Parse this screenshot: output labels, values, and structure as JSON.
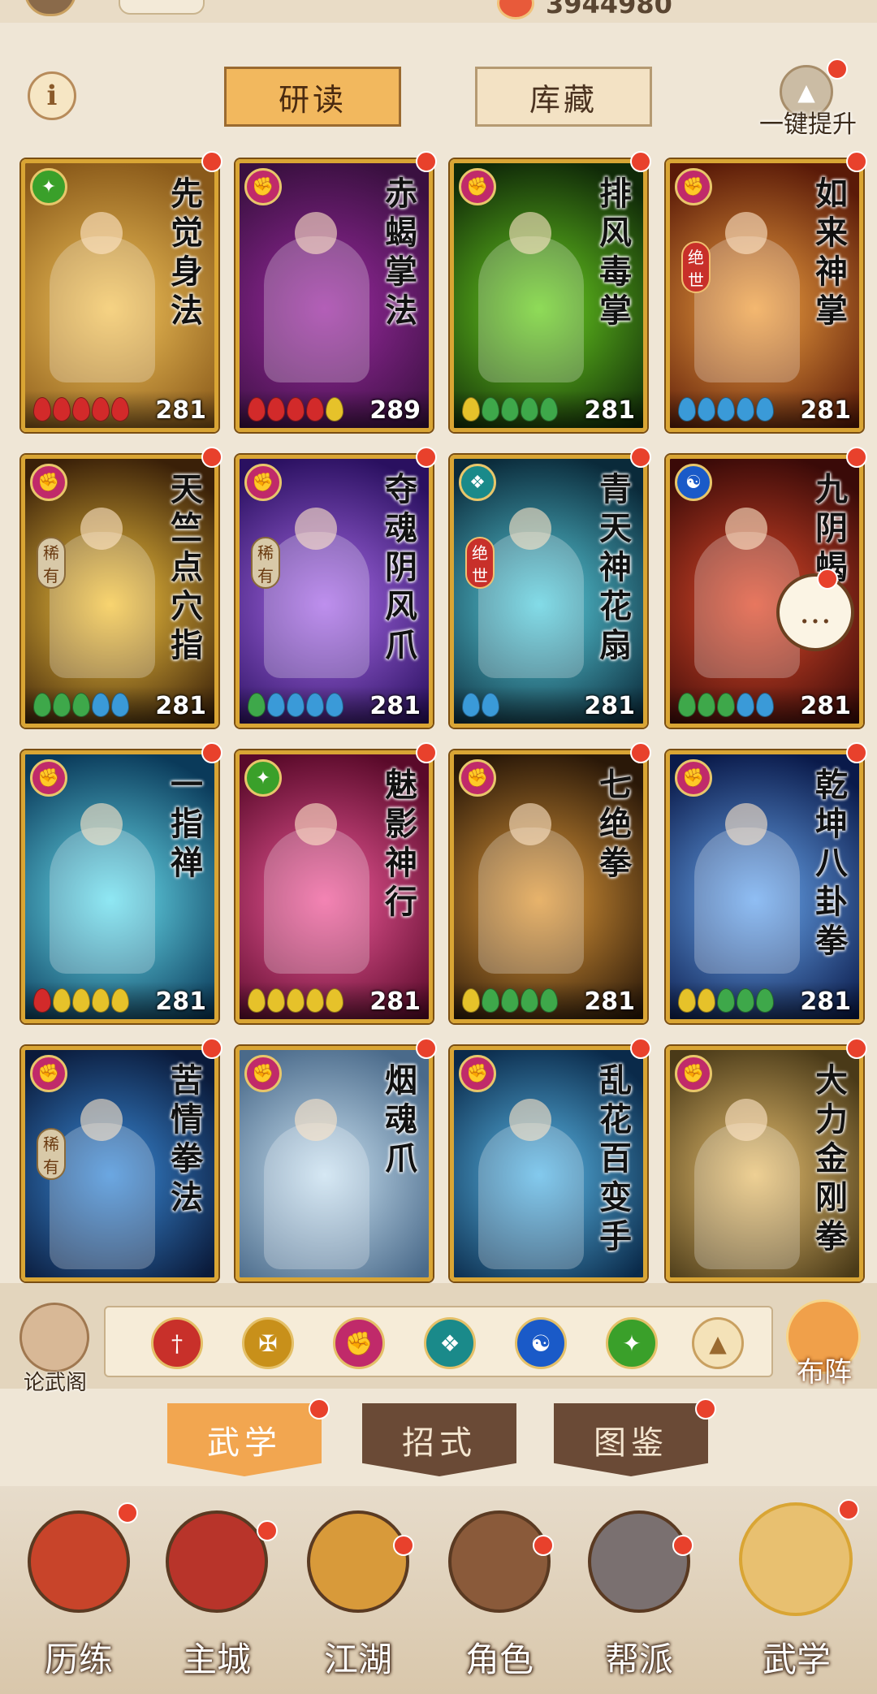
{
  "top": {
    "coins": "3944980"
  },
  "header": {
    "info_label": "i",
    "tab_study": "研读",
    "tab_store": "库藏",
    "one_key_upgrade": "一键提升"
  },
  "cards": [
    {
      "name": "先觉身法",
      "level": "281",
      "tag": "",
      "badge": "leaf-icon",
      "beads": [
        "r",
        "r",
        "r",
        "r",
        "r"
      ],
      "colors": [
        "#f3c45a",
        "#8a5a1a"
      ]
    },
    {
      "name": "赤蝎掌法",
      "level": "289",
      "tag": "",
      "badge": "fist-icon",
      "beads": [
        "r",
        "r",
        "r",
        "r",
        "y"
      ],
      "colors": [
        "#9a2aa0",
        "#3a1040"
      ]
    },
    {
      "name": "排风毒掌",
      "level": "281",
      "tag": "",
      "badge": "fist-icon",
      "beads": [
        "y",
        "g",
        "g",
        "g",
        "g"
      ],
      "colors": [
        "#6ad020",
        "#102a08"
      ]
    },
    {
      "name": "如来神掌",
      "level": "281",
      "tag": "绝世",
      "badge": "fist-icon",
      "beads": [
        "b",
        "b",
        "b",
        "b",
        "b"
      ],
      "colors": [
        "#f0a040",
        "#5a1a08"
      ]
    },
    {
      "name": "天竺点穴指",
      "level": "281",
      "tag": "稀有",
      "badge": "fist-icon",
      "beads": [
        "g",
        "g",
        "g",
        "b",
        "b"
      ],
      "colors": [
        "#f6c640",
        "#3a2008"
      ]
    },
    {
      "name": "夺魂阴风爪",
      "level": "281",
      "tag": "稀有",
      "badge": "fist-icon",
      "beads": [
        "g",
        "b",
        "b",
        "b",
        "b"
      ],
      "colors": [
        "#a86ae8",
        "#2a1060"
      ]
    },
    {
      "name": "青天神花扇",
      "level": "281",
      "tag": "绝世",
      "badge": "fan-icon",
      "beads": [
        "b",
        "b"
      ],
      "colors": [
        "#5ad0e0",
        "#0a2a3a"
      ]
    },
    {
      "name": "九阴蝎",
      "level": "281",
      "tag": "",
      "badge": "taiji-icon",
      "beads": [
        "g",
        "g",
        "g",
        "b",
        "b"
      ],
      "colors": [
        "#e04a2a",
        "#3a0a08"
      ]
    },
    {
      "name": "一指禅",
      "level": "281",
      "tag": "",
      "badge": "fist-icon",
      "beads": [
        "r",
        "y",
        "y",
        "y",
        "y"
      ],
      "colors": [
        "#6ae0f0",
        "#0a3a5a"
      ]
    },
    {
      "name": "魅影神行",
      "level": "281",
      "tag": "",
      "badge": "leaf-icon",
      "beads": [
        "y",
        "y",
        "y",
        "y",
        "y"
      ],
      "colors": [
        "#f05a9a",
        "#5a0a2a"
      ]
    },
    {
      "name": "七绝拳",
      "level": "281",
      "tag": "",
      "badge": "fist-icon",
      "beads": [
        "y",
        "g",
        "g",
        "g",
        "g"
      ],
      "colors": [
        "#e09a3a",
        "#2a1808"
      ]
    },
    {
      "name": "乾坤八卦拳",
      "level": "281",
      "tag": "",
      "badge": "fist-icon",
      "beads": [
        "y",
        "y",
        "g",
        "g",
        "g"
      ],
      "colors": [
        "#6aa8f0",
        "#0a1a4a"
      ]
    },
    {
      "name": "苦情拳法",
      "level": "",
      "tag": "稀有",
      "badge": "fist-icon",
      "beads": [],
      "colors": [
        "#3a8ad8",
        "#0a1a3a"
      ]
    },
    {
      "name": "烟魂爪",
      "level": "",
      "tag": "",
      "badge": "fist-icon",
      "beads": [],
      "colors": [
        "#c8e0f0",
        "#4a6a8a"
      ]
    },
    {
      "name": "乱花百变手",
      "level": "",
      "tag": "",
      "badge": "fist-icon",
      "beads": [],
      "colors": [
        "#5ab8e8",
        "#0a2a4a"
      ]
    },
    {
      "name": "大力金刚拳",
      "level": "",
      "tag": "",
      "badge": "fist-icon",
      "beads": [],
      "colors": [
        "#e8c070",
        "#4a3a18"
      ]
    }
  ],
  "filters": [
    {
      "name": "sword-icon",
      "color": "#c8302a"
    },
    {
      "name": "blade-icon",
      "color": "#c8901a"
    },
    {
      "name": "fist-icon",
      "color": "#c02a6a"
    },
    {
      "name": "fan-icon",
      "color": "#1a8a8a"
    },
    {
      "name": "taiji-icon",
      "color": "#1a5ac8"
    },
    {
      "name": "leaf-icon",
      "color": "#3aa02a"
    }
  ],
  "side": {
    "lunwu": "论武阁",
    "buzhen": "布阵"
  },
  "subtabs": {
    "a": "武学",
    "b": "招式",
    "c": "图鉴"
  },
  "nav": {
    "a": "历练",
    "b": "主城",
    "c": "江湖",
    "d": "角色",
    "e": "帮派",
    "f": "武学"
  }
}
